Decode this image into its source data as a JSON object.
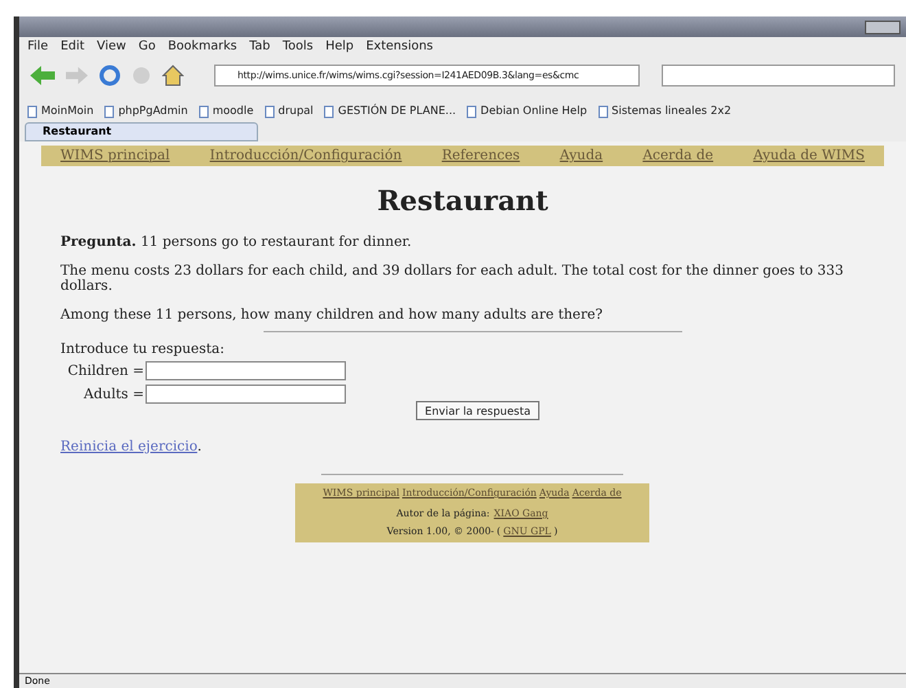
{
  "menu": [
    "File",
    "Edit",
    "View",
    "Go",
    "Bookmarks",
    "Tab",
    "Tools",
    "Help",
    "Extensions"
  ],
  "address": {
    "value": "http://wims.unice.fr/wims/wims.cgi?session=I241AED09B.3&lang=es&cmc"
  },
  "bookmarks": [
    "MoinMoin",
    "phpPgAdmin",
    "moodle",
    "drupal",
    "GESTIÓN DE PLANE...",
    "Debian Online Help",
    "Sistemas lineales 2x2"
  ],
  "tabs": [
    {
      "label": "Restaurant",
      "selected": true
    }
  ],
  "page": {
    "nav": [
      "WIMS principal",
      "Introducción/Configuración",
      "References",
      "Ayuda",
      "Acerda de",
      "Ayuda de WIMS"
    ],
    "title": "Restaurant",
    "question": "**Pregunta.** 11 persons go to restaurant for dinner.",
    "statement": "The menu costs 23 dollars for each child, and 39 dollars for each adult. The total cost for the dinner goes to 333 dollars.",
    "ask": "Among these 11 persons, how many children and how many adults are there?",
    "prompt": "Introduce tu respuesta:",
    "fields": [
      {
        "label": "Children ="
      },
      {
        "label": "Adults ="
      }
    ],
    "submit": "Enviar la respuesta",
    "restart": {
      "link": "Reinicia el ejercicio",
      "tail": "."
    },
    "footer": {
      "links": [
        "WIMS principal",
        "Introducción/Configuración",
        "Ayuda",
        "Acerda de"
      ],
      "author_label": "Autor de la página:",
      "author": "XIAO Gang",
      "version": "Version 1.00, © 2000-",
      "license_open": "(",
      "license": "GNU GPL",
      "license_close": ")"
    }
  },
  "status_bar": "Done"
}
